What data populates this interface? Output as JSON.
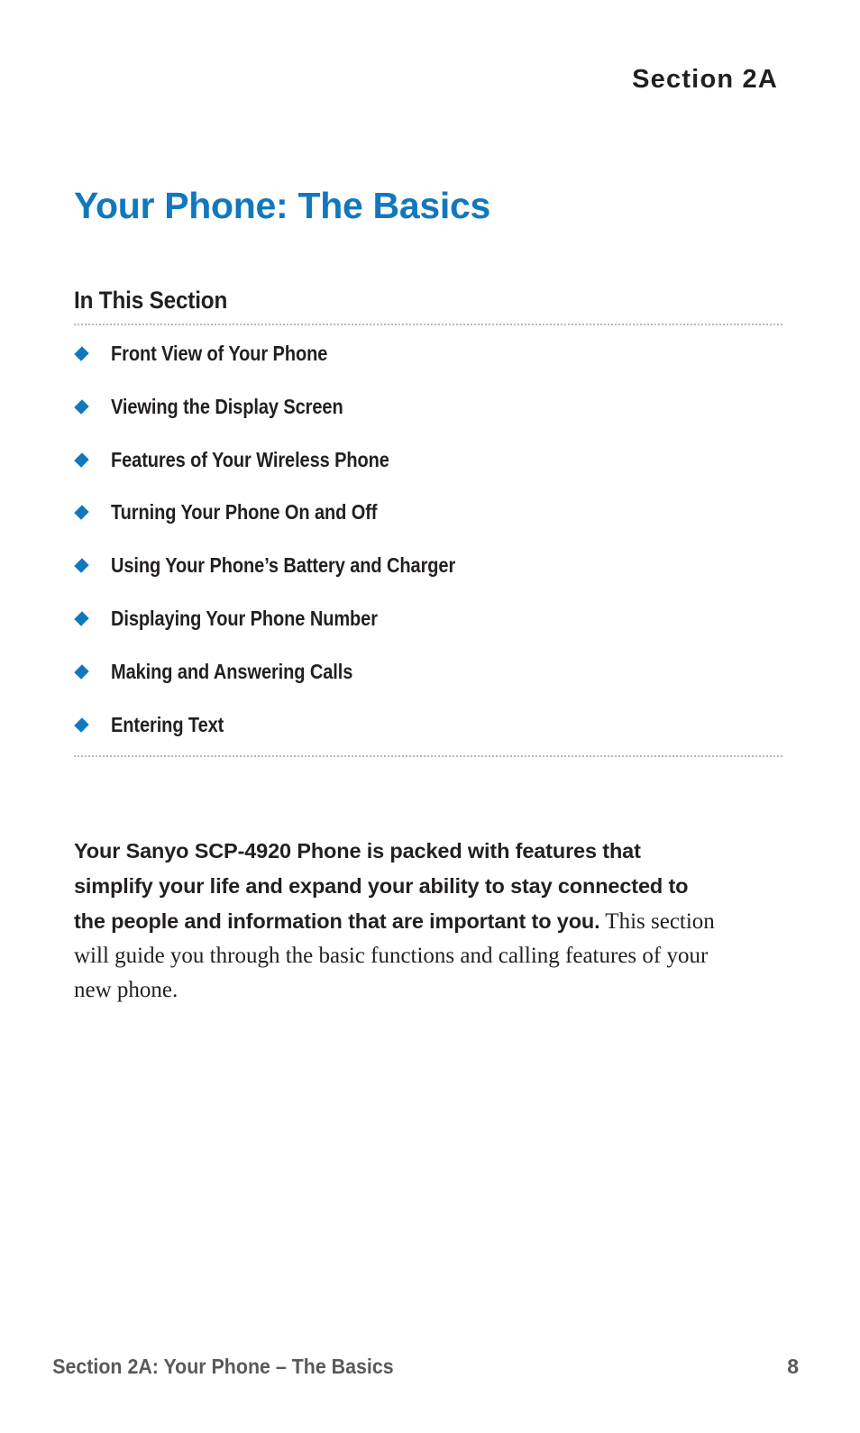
{
  "header": {
    "section_label": "Section 2A"
  },
  "title": {
    "text": "Your Phone: The Basics",
    "color": "#1278be"
  },
  "in_this_section": {
    "heading": "In This Section",
    "bullet_color": "#1278be",
    "items": [
      {
        "label": "Front View of Your Phone"
      },
      {
        "label": "Viewing the Display Screen"
      },
      {
        "label": "Features of Your Wireless Phone"
      },
      {
        "label": "Turning Your Phone On and Off"
      },
      {
        "label": "Using Your Phone’s Battery and Charger"
      },
      {
        "label": "Displaying Your Phone Number"
      },
      {
        "label": "Making and Answering Calls"
      },
      {
        "label": "Entering Text"
      }
    ]
  },
  "body": {
    "lead_in": "Your Sanyo SCP-4920 Phone is packed with features that simplify your life and expand your ability to stay connected to the people and information that are important to you.",
    "rest": " This section will guide you through the basic functions and calling features of your new phone."
  },
  "footer": {
    "text": "Section 2A: Your Phone – The Basics",
    "page_number": "8",
    "color": "#58595b"
  }
}
